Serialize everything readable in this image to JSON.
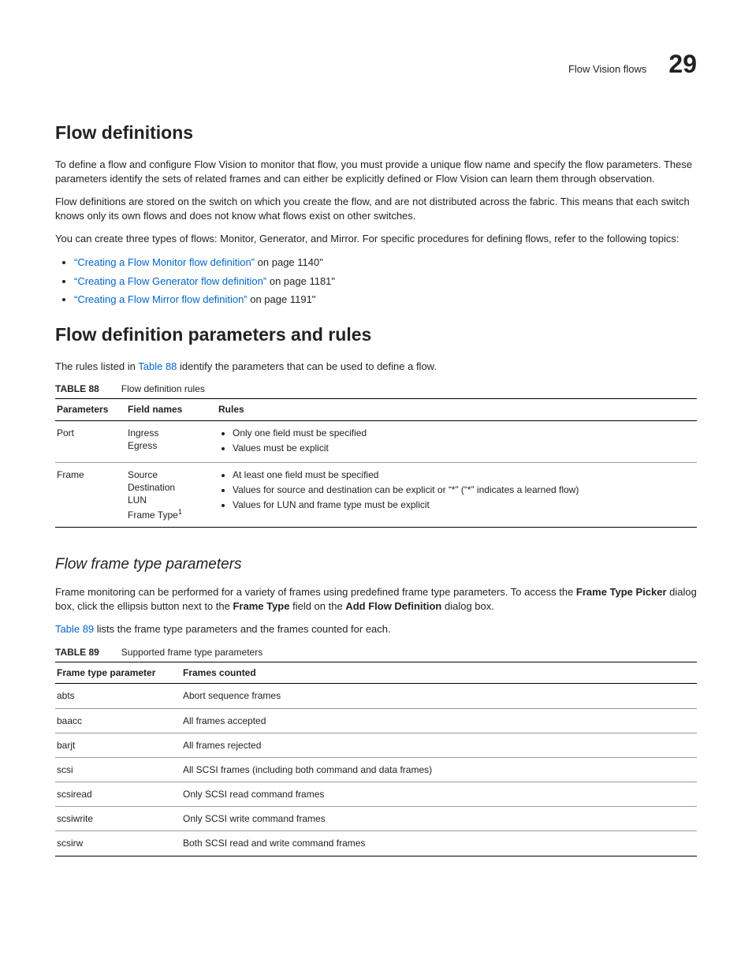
{
  "header": {
    "section_label": "Flow Vision flows",
    "chapter_num": "29"
  },
  "h1_flowdef": "Flow definitions",
  "p1": "To define a flow and configure Flow Vision to monitor that flow, you must provide a unique flow name and specify the flow parameters. These parameters identify the sets of related frames and can either be explicitly defined or Flow Vision can learn them through observation.",
  "p2": "Flow definitions are stored on the switch on which you create the flow, and are not distributed across the fabric. This means that each switch knows only its own flows and does not know what flows exist on other switches.",
  "p3": "You can create three types of flows: Monitor, Generator, and Mirror. For specific procedures for defining flows, refer to the following topics:",
  "xrefs": [
    {
      "link": "“Creating a Flow Monitor flow definition”",
      "suffix": " on page 1140\""
    },
    {
      "link": "“Creating a Flow Generator flow definition”",
      "suffix": " on page 1181\""
    },
    {
      "link": "“Creating a Flow Mirror flow definition”",
      "suffix": " on page 1191\""
    }
  ],
  "h1_params": "Flow definition parameters and rules",
  "p4_pre": "The rules listed in ",
  "p4_ref": "Table 88",
  "p4_post": " identify the parameters that can be used to define a flow.",
  "table88": {
    "label": "TABLE 88",
    "title": "Flow definition rules",
    "headers": [
      "Parameters",
      "Field names",
      "Rules"
    ],
    "rows": [
      {
        "param": "Port",
        "fields": [
          "Ingress",
          "Egress"
        ],
        "rules": [
          "Only one field must be specified",
          "Values must be explicit"
        ]
      },
      {
        "param": "Frame",
        "fields": [
          "Source",
          "Destination",
          "LUN",
          "Frame Type"
        ],
        "fields_sup": "1",
        "rules": [
          "At least one field must be specified",
          "Values for source and destination can be explicit or “*” (“*” indicates a learned flow)",
          "Values for LUN and frame type must be explicit"
        ]
      }
    ]
  },
  "h2_frametype": "Flow frame type parameters",
  "p5_pre": "Frame monitoring can be performed for a variety of frames using predefined frame type parameters. To access the ",
  "p5_b1": "Frame Type Picker",
  "p5_mid1": " dialog box, click the ellipsis button next to the ",
  "p5_b2": "Frame Type",
  "p5_mid2": " field on the ",
  "p5_b3": "Add Flow Definition",
  "p5_post": " dialog box.",
  "p6_ref": "Table 89",
  "p6_post": " lists the frame type parameters and the frames counted for each.",
  "table89": {
    "label": "TABLE 89",
    "title": "Supported frame type parameters",
    "headers": [
      "Frame type parameter",
      "Frames counted"
    ],
    "rows": [
      {
        "c0": "abts",
        "c1": "Abort sequence frames"
      },
      {
        "c0": "baacc",
        "c1": "All frames accepted"
      },
      {
        "c0": "barjt",
        "c1": "All frames rejected"
      },
      {
        "c0": "scsi",
        "c1": "All SCSI frames (including both command and data frames)"
      },
      {
        "c0": "scsiread",
        "c1": "Only SCSI read command frames"
      },
      {
        "c0": "scsiwrite",
        "c1": "Only SCSI write command frames"
      },
      {
        "c0": "scsirw",
        "c1": "Both SCSI read and write command frames"
      }
    ]
  }
}
